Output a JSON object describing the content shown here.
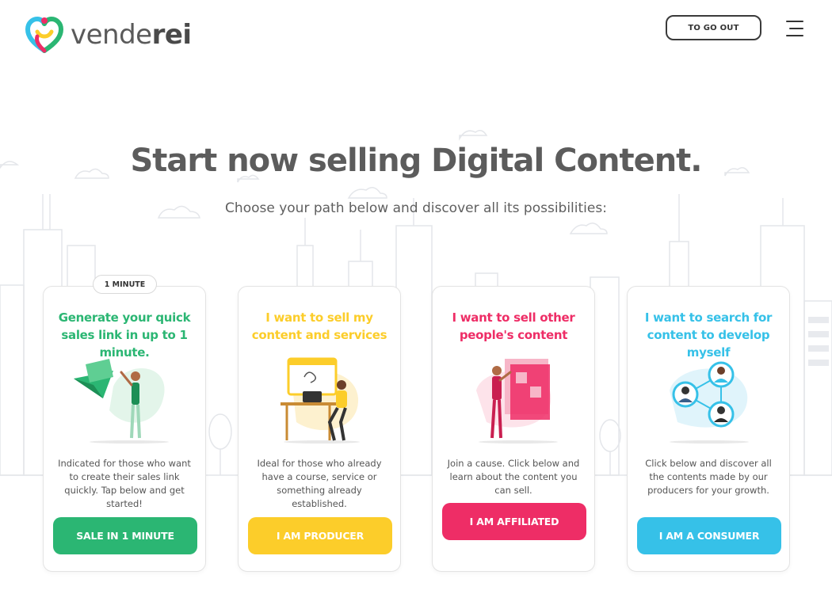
{
  "header": {
    "logo_text_light": "vende",
    "logo_text_bold": "rei",
    "logout_label": "TO GO OUT"
  },
  "hero": {
    "title": "Start now selling Digital Content.",
    "subtitle": "Choose your path below and discover all its possibilities:"
  },
  "colors": {
    "green": "#2bb673",
    "yellow": "#fccd2a",
    "pink": "#ee2d66",
    "blue": "#36c1e8"
  },
  "cards": [
    {
      "badge": "1 MINUTE",
      "title": "Generate your quick sales link in up to 1 minute.",
      "description": "Indicated for those who want to create their sales link quickly. Tap below and get started!",
      "button": "SALE IN 1 MINUTE"
    },
    {
      "title": "I want to sell my content and services",
      "description": "Ideal for those who already have a course, service or something already established.",
      "button": "I AM PRODUCER"
    },
    {
      "title": "I want to sell other people's content",
      "description": "Join a cause. Click below and learn about the content you can sell.",
      "button": "I AM AFFILIATED"
    },
    {
      "title": "I want to search for content to develop myself",
      "description": "Click below and discover all the contents made by our producers for your growth.",
      "button": "I AM A CONSUMER"
    }
  ]
}
